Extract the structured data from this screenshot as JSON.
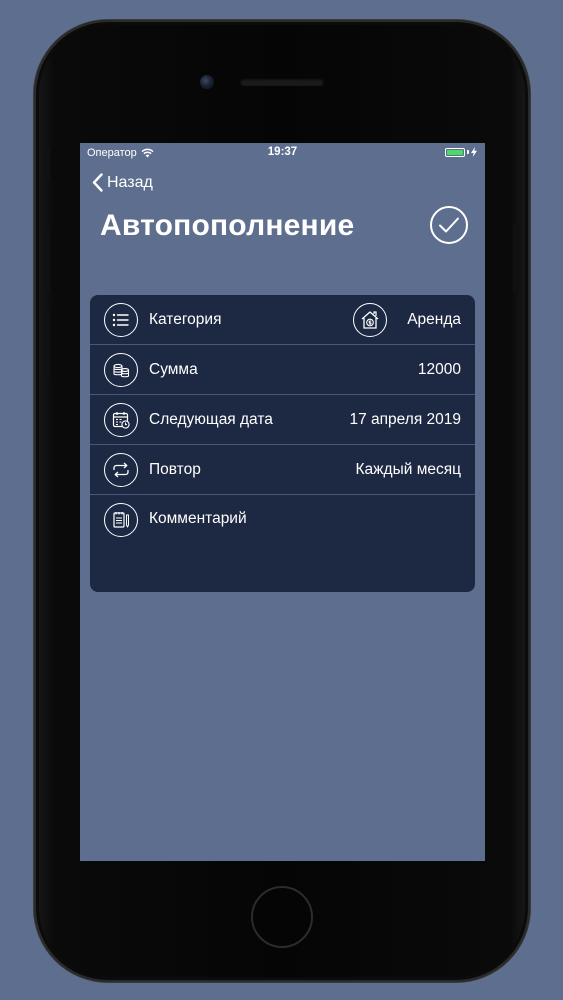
{
  "status_bar": {
    "carrier": "Оператор",
    "time": "19:37",
    "battery_color": "#4cd964"
  },
  "nav": {
    "back_label": "Назад",
    "back_icon": "chevron-left-icon",
    "title": "Автопополнение",
    "done_icon": "checkmark-icon"
  },
  "form": {
    "rows": [
      {
        "label": "Категория",
        "value": "Аренда",
        "icon": "list-icon",
        "value_icon": "house-money-icon"
      },
      {
        "label": "Сумма",
        "value": "12000",
        "icon": "coins-icon"
      },
      {
        "label": "Следующая дата",
        "value": "17 апреля 2019",
        "icon": "calendar-icon"
      },
      {
        "label": "Повтор",
        "value": "Каждый месяц",
        "icon": "repeat-icon"
      },
      {
        "label": "Комментарий",
        "value": "",
        "icon": "notepad-icon"
      }
    ]
  },
  "colors": {
    "background": "#5e6e8e",
    "card": "#1d2843",
    "divider": "#4a5674"
  }
}
